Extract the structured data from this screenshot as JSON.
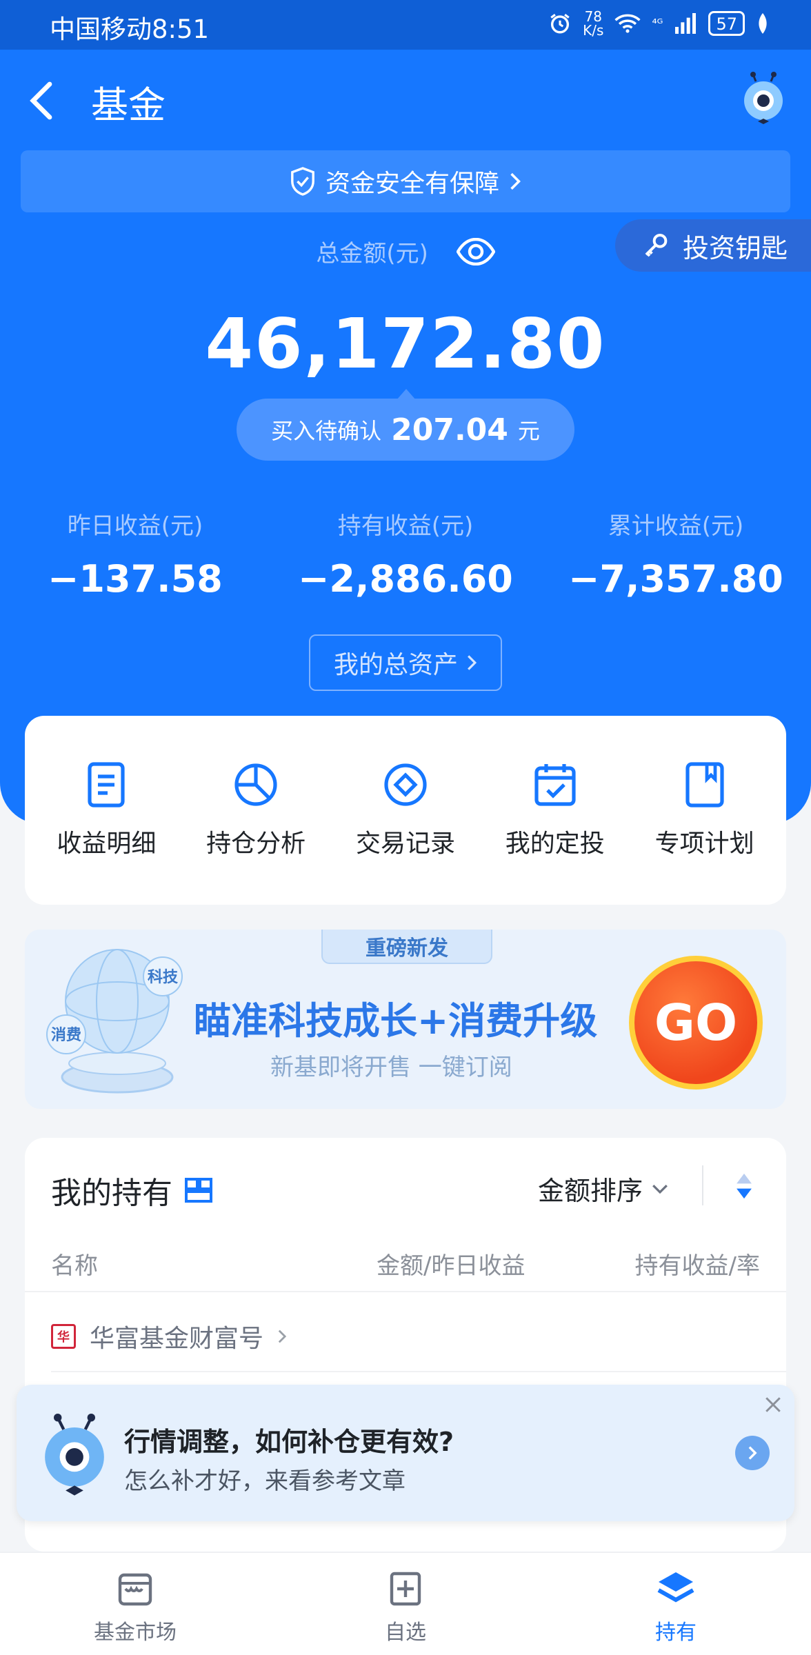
{
  "status_bar": {
    "carrier_time": "中国移动8:51",
    "net_speed_top": "78",
    "net_speed_unit": "K/s",
    "signal": "⁴ᴳ",
    "battery": "57"
  },
  "nav": {
    "title": "基金"
  },
  "safety_banner": {
    "text": "资金安全有保障"
  },
  "key_button": {
    "label": "投资钥匙"
  },
  "summary": {
    "total_label": "总金额(元)",
    "total_amount": "46,172.80",
    "pending_label": "买入待确认",
    "pending_value": "207.04",
    "pending_unit": "元",
    "stats": [
      {
        "label": "昨日收益(元)",
        "value": "−137.58"
      },
      {
        "label": "持有收益(元)",
        "value": "−2,886.60"
      },
      {
        "label": "累计收益(元)",
        "value": "−7,357.80"
      }
    ],
    "assets_button": "我的总资产"
  },
  "menu": [
    {
      "label": "收益明细",
      "icon": "document-icon"
    },
    {
      "label": "持仓分析",
      "icon": "pie-chart-icon"
    },
    {
      "label": "交易记录",
      "icon": "diamond-icon"
    },
    {
      "label": "我的定投",
      "icon": "calendar-check-icon"
    },
    {
      "label": "专项计划",
      "icon": "bookmark-icon"
    }
  ],
  "promo": {
    "tag": "重磅新发",
    "title": "瞄准科技成长+消费升级",
    "subtitle": "新基即将开售 一键订阅",
    "bubble_tech": "科技",
    "bubble_consume": "消费",
    "go": "GO"
  },
  "holdings": {
    "title": "我的持有",
    "sort_label": "金额排序",
    "columns": [
      "名称",
      "金额/昨日收益",
      "持有收益/率"
    ],
    "fund_company": "华富基金财富号"
  },
  "tip": {
    "title": "行情调整，如何补仓更有效?",
    "subtitle": "怎么补才好，来看参考文章"
  },
  "tabbar": [
    {
      "label": "基金市场",
      "active": false
    },
    {
      "label": "自选",
      "active": false
    },
    {
      "label": "持有",
      "active": true
    }
  ],
  "colors": {
    "primary": "#1677ff",
    "accent_go": "#f0461c",
    "go_border": "#ffcf3a"
  }
}
